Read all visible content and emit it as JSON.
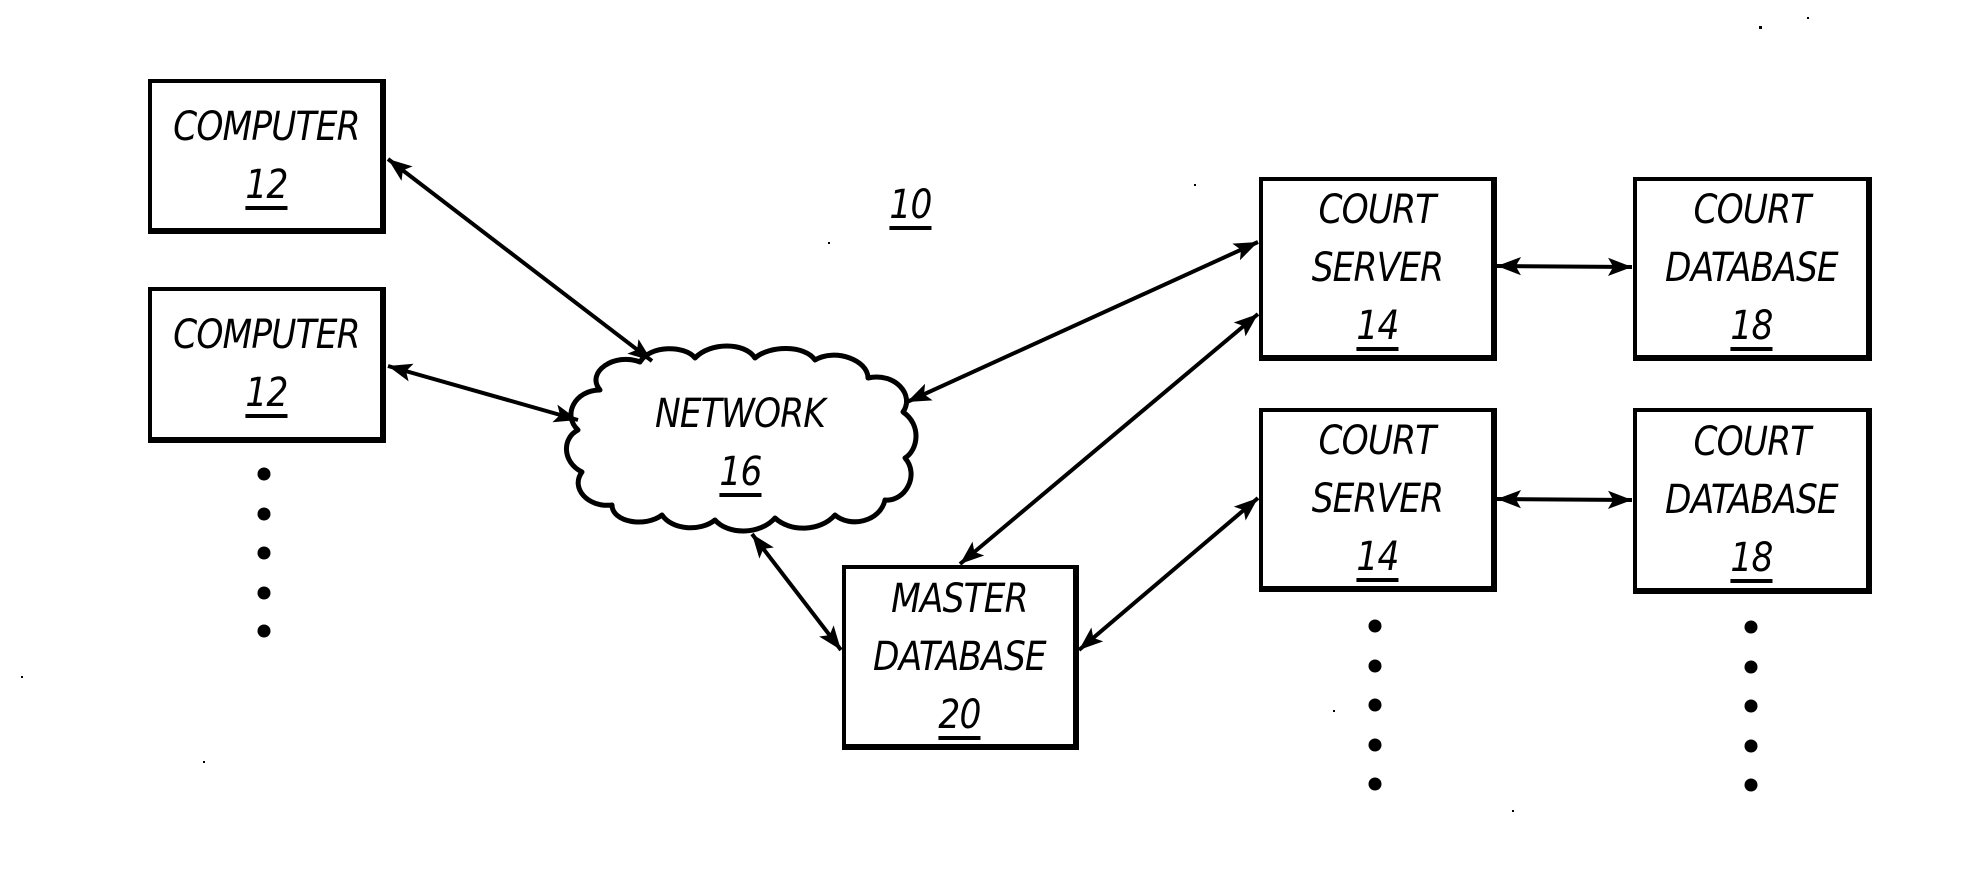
{
  "figure": {
    "reference_number": "10"
  },
  "nodes": {
    "computer_1": {
      "label": "COMPUTER",
      "ref": "12"
    },
    "computer_2": {
      "label": "COMPUTER",
      "ref": "12"
    },
    "network": {
      "label": "NETWORK",
      "ref": "16"
    },
    "master_database": {
      "label_line1": "MASTER",
      "label_line2": "DATABASE",
      "ref": "20"
    },
    "court_server_1": {
      "label_line1": "COURT",
      "label_line2": "SERVER",
      "ref": "14"
    },
    "court_server_2": {
      "label_line1": "COURT",
      "label_line2": "SERVER",
      "ref": "14"
    },
    "court_database_1": {
      "label_line1": "COURT",
      "label_line2": "DATABASE",
      "ref": "18"
    },
    "court_database_2": {
      "label_line1": "COURT",
      "label_line2": "DATABASE",
      "ref": "18"
    }
  },
  "connections": [
    {
      "from": "computer_1",
      "to": "network",
      "type": "bidirectional"
    },
    {
      "from": "computer_2",
      "to": "network",
      "type": "bidirectional"
    },
    {
      "from": "network",
      "to": "court_server_1",
      "type": "bidirectional"
    },
    {
      "from": "network",
      "to": "master_database",
      "type": "bidirectional"
    },
    {
      "from": "master_database",
      "to": "court_server_1",
      "type": "bidirectional"
    },
    {
      "from": "master_database",
      "to": "court_server_2",
      "type": "bidirectional"
    },
    {
      "from": "court_server_1",
      "to": "court_database_1",
      "type": "bidirectional"
    },
    {
      "from": "court_server_2",
      "to": "court_database_2",
      "type": "bidirectional"
    }
  ],
  "continuation_markers": {
    "computers": "more computers (ellipsis)",
    "court_servers": "more court servers (ellipsis)",
    "court_databases": "more court databases (ellipsis)"
  },
  "colors": {
    "ink": "#000000",
    "paper": "#ffffff"
  }
}
